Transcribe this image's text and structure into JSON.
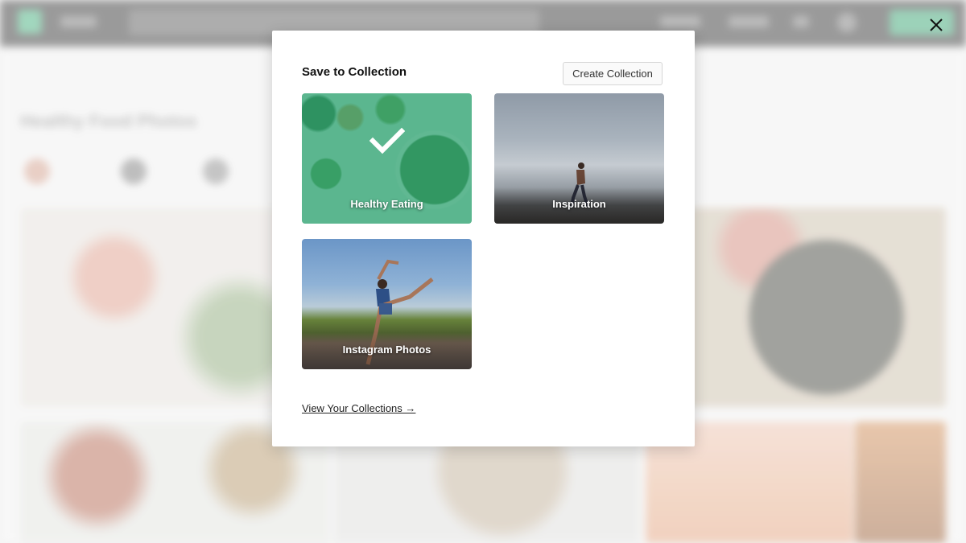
{
  "modal": {
    "title": "Save to Collection",
    "create_button": "Create Collection",
    "collections": [
      {
        "name": "Healthy Eating",
        "selected": true
      },
      {
        "name": "Inspiration",
        "selected": false
      },
      {
        "name": "Instagram Photos",
        "selected": false
      }
    ],
    "view_link": "View Your Collections →"
  },
  "background": {
    "page_title": "Healthy Food Photos"
  },
  "colors": {
    "selected_overlay": "#2ea878",
    "modal_bg": "#ffffff"
  },
  "icons": {
    "close": "close-icon",
    "check": "check-icon"
  }
}
